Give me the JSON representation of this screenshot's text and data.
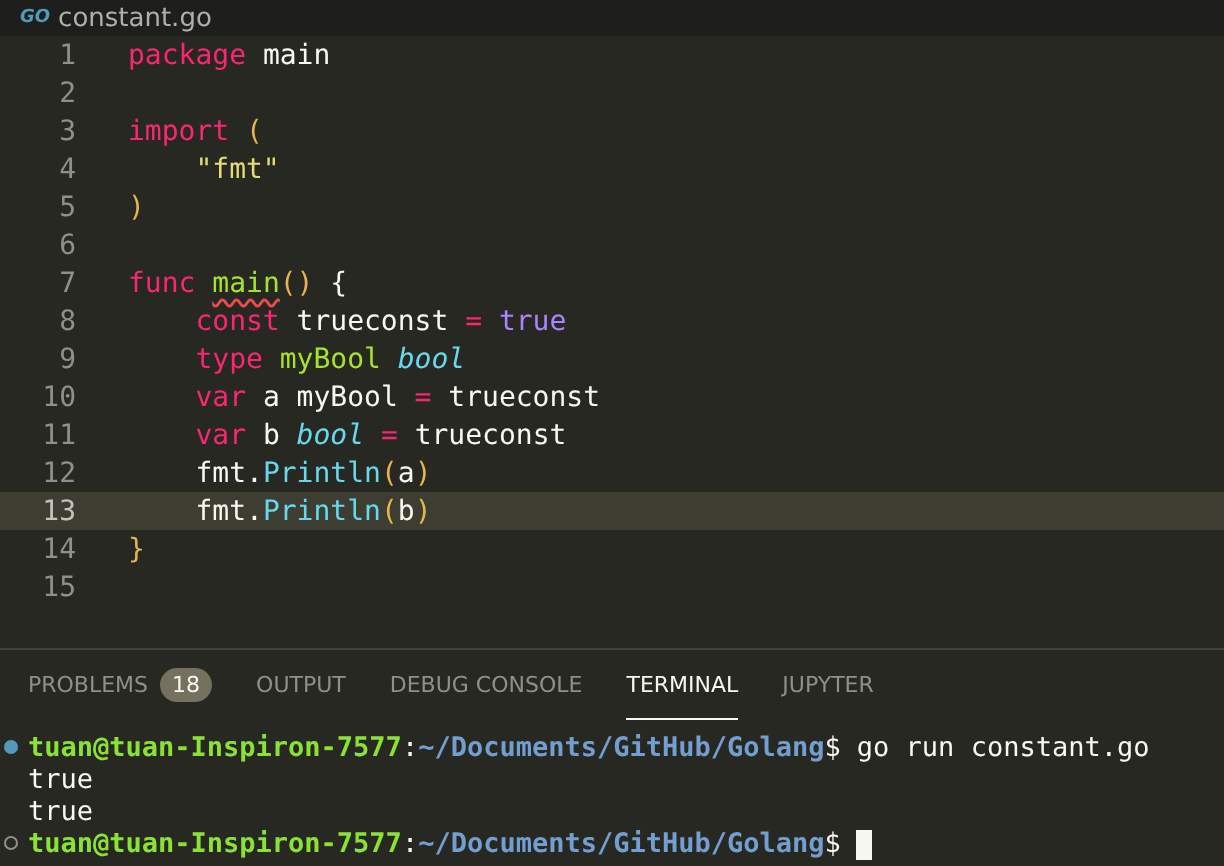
{
  "editor": {
    "tab": {
      "icon_text": "GO",
      "filename": "constant.go"
    },
    "lines": [
      {
        "number": "1",
        "current": false,
        "tokens": [
          {
            "kind": "keyword",
            "text": "package"
          },
          {
            "kind": "plain",
            "text": " main"
          }
        ]
      },
      {
        "number": "2",
        "current": false
      },
      {
        "number": "3",
        "current": false,
        "tokens": [
          {
            "kind": "keyword",
            "text": "import"
          },
          {
            "kind": "paren",
            "text": " ("
          }
        ]
      },
      {
        "number": "4",
        "current": false,
        "tokens": [
          {
            "kind": "string",
            "text": "    \"fmt\""
          }
        ]
      },
      {
        "number": "5",
        "current": false,
        "tokens": [
          {
            "kind": "paren",
            "text": ")"
          }
        ]
      },
      {
        "number": "6",
        "current": false
      },
      {
        "number": "7",
        "current": false,
        "tokens": [
          {
            "kind": "keyword",
            "text": "func "
          },
          {
            "kind": "function",
            "text": "main",
            "squiggle": true
          },
          {
            "kind": "paren",
            "text": "()"
          },
          {
            "kind": "plain",
            "text": " {"
          }
        ]
      },
      {
        "number": "8",
        "current": false,
        "tokens": [
          {
            "kind": "keyword",
            "text": "    const"
          },
          {
            "kind": "plain",
            "text": " trueconst"
          },
          {
            "kind": "keyword",
            "text": " ="
          },
          {
            "kind": "constant",
            "text": " true"
          }
        ]
      },
      {
        "number": "9",
        "current": false,
        "tokens": [
          {
            "kind": "keyword",
            "text": "    type"
          },
          {
            "kind": "function",
            "text": " myBool"
          },
          {
            "kind": "type",
            "text": " bool"
          }
        ]
      },
      {
        "number": "10",
        "current": false,
        "tokens": [
          {
            "kind": "keyword",
            "text": "    var"
          },
          {
            "kind": "plain",
            "text": " a myBool"
          },
          {
            "kind": "keyword",
            "text": " ="
          },
          {
            "kind": "plain",
            "text": " trueconst"
          }
        ]
      },
      {
        "number": "11",
        "current": false,
        "tokens": [
          {
            "kind": "keyword",
            "text": "    var"
          },
          {
            "kind": "plain",
            "text": " b"
          },
          {
            "kind": "type",
            "text": " bool"
          },
          {
            "kind": "keyword",
            "text": " ="
          },
          {
            "kind": "plain",
            "text": " trueconst"
          }
        ]
      },
      {
        "number": "12",
        "current": false,
        "tokens": [
          {
            "kind": "plain",
            "text": "    fmt."
          },
          {
            "kind": "method",
            "text": "Println"
          },
          {
            "kind": "paren",
            "text": "("
          },
          {
            "kind": "plain",
            "text": "a"
          },
          {
            "kind": "paren",
            "text": ")"
          }
        ]
      },
      {
        "number": "13",
        "current": true,
        "tokens": [
          {
            "kind": "plain",
            "text": "    fmt."
          },
          {
            "kind": "method",
            "text": "Println"
          },
          {
            "kind": "paren",
            "text": "("
          },
          {
            "kind": "plain",
            "text": "b"
          },
          {
            "kind": "paren",
            "text": ")"
          }
        ]
      },
      {
        "number": "14",
        "current": false,
        "tokens": [
          {
            "kind": "paren",
            "text": "}"
          }
        ]
      },
      {
        "number": "15",
        "current": false
      }
    ]
  },
  "panel": {
    "tabs": [
      {
        "label": "PROBLEMS",
        "badge": "18",
        "selected": false
      },
      {
        "label": "OUTPUT",
        "selected": false
      },
      {
        "label": "DEBUG CONSOLE",
        "selected": false
      },
      {
        "label": "TERMINAL",
        "selected": true
      },
      {
        "label": "JUPYTER",
        "selected": false
      }
    ],
    "terminal": [
      {
        "kind": "prompt",
        "user": "tuan@tuan-Inspiron-7577",
        "separator": ":",
        "path": "~/Documents/GitHub/Golang",
        "prompt_char": "$",
        "command": "go run constant.go",
        "finished": true
      },
      {
        "kind": "output",
        "text": "true"
      },
      {
        "kind": "output",
        "text": "true"
      },
      {
        "kind": "prompt",
        "user": "tuan@tuan-Inspiron-7577",
        "separator": ":",
        "path": "~/Documents/GitHub/Golang",
        "prompt_char": "$",
        "finished": false,
        "cursor": true
      }
    ]
  }
}
